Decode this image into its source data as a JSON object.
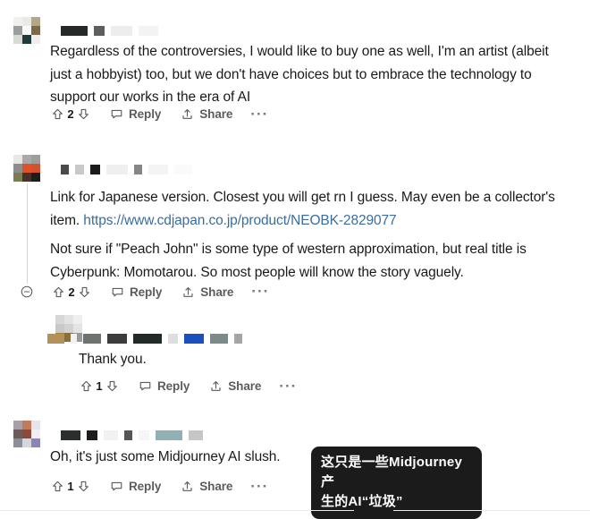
{
  "page": {
    "title": "Reddit comment thread",
    "link_color": "#3a6d9e",
    "text_color": "#1a1a1b",
    "meta_color": "#5c5c5e",
    "tooltip_bg": "#1b1b1b"
  },
  "icons": {
    "upvote": "upvote-arrow-icon",
    "downvote": "downvote-arrow-icon",
    "reply": "reply-bubble-icon",
    "share": "share-arrow-icon",
    "overflow": "overflow-ellipsis-icon",
    "collapse": "collapse-minus-circle-icon"
  },
  "labels": {
    "reply": "Reply",
    "share": "Share",
    "overflow": "···"
  },
  "comments": [
    {
      "id": "comment-1",
      "author_redacted": true,
      "score": "2",
      "text": "Regardless of the controversies, I would like to buy one as well, I'm an artist (albeit just a hobbyist) too, but we don't have choices but to embrace the technology to support our works in the era of AI",
      "reply_label": "Reply",
      "share_label": "Share"
    },
    {
      "id": "comment-2",
      "author_redacted": true,
      "score": "2",
      "paragraph_1_before_link": "Link for Japanese version. Closest you will get rn I guess. May even be a collector's item. ",
      "link_text": "https://www.cdjapan.co.jp/product/NEOBK-2829077",
      "paragraph_2": "Not sure if \"Peach John\" is some type of western approximation, but real title is Cyberpunk: Momotarou. So most people will know the story vaguely.",
      "reply_label": "Reply",
      "share_label": "Share",
      "has_collapse": true
    },
    {
      "id": "comment-3",
      "author_redacted": true,
      "score": "1",
      "text": "Thank you.",
      "reply_label": "Reply",
      "share_label": "Share",
      "nested": true
    },
    {
      "id": "comment-4",
      "author_redacted": true,
      "score": "1",
      "text": "Oh, it's just some Midjourney AI slush.",
      "reply_label": "Reply",
      "share_label": "Share"
    }
  ],
  "tooltip": {
    "line_1": "这只是一些Midjourney产",
    "line_2": "生的AI“垃圾”"
  }
}
